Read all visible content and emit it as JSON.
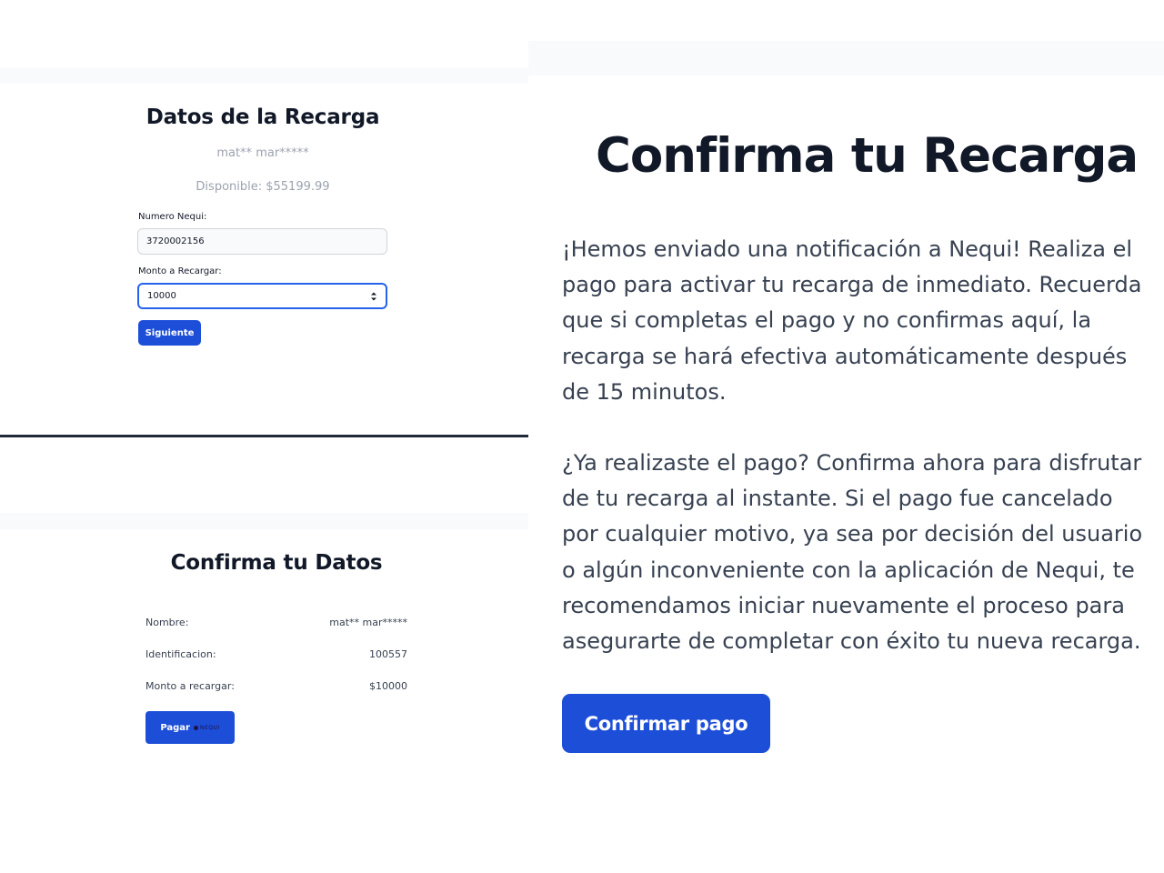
{
  "recarga": {
    "title": "Datos de la Recarga",
    "user": "mat** mar*****",
    "balance": "Disponible: $55199.99",
    "numero_label": "Numero Nequi:",
    "numero_value": "3720002156",
    "monto_label": "Monto a Recargar:",
    "monto_value": "10000",
    "next_button": "Siguiente"
  },
  "datos": {
    "title": "Confirma tu Datos",
    "rows": [
      {
        "label": "Nombre:",
        "value": "mat** mar*****"
      },
      {
        "label": "Identificacion:",
        "value": "100557"
      },
      {
        "label": "Monto a recargar:",
        "value": "$10000"
      }
    ],
    "pay_button": "Pagar",
    "pay_logo_text": "NEQUI"
  },
  "confirma": {
    "title": "Confirma tu Recarga",
    "paragraph1": "¡Hemos enviado una notificación a Nequi! Realiza el pago para activar tu recarga de inmediato. Recuerda que si completas el pago y no confirmas aquí, la recarga se hará efectiva automáticamente después de 15 minutos.",
    "paragraph2": "¿Ya realizaste el pago? Confirma ahora para disfrutar de tu recarga al instante. Si el pago fue cancelado por cualquier motivo, ya sea por decisión del usuario o algún inconveniente con la aplicación de Nequi, te recomendamos iniciar nuevamente el proceso para asegurarte de completar con éxito tu nueva recarga.",
    "confirm_button": "Confirmar pago"
  },
  "colors": {
    "primary": "#1d4ed8",
    "focus_border": "#2563eb",
    "muted_text": "#9ca3af",
    "nequi_brand": "#1f1147"
  }
}
